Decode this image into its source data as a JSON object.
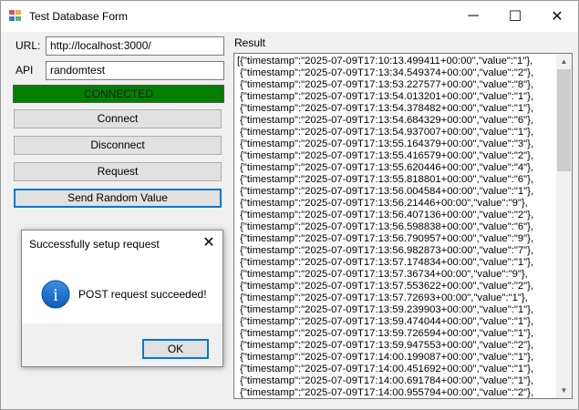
{
  "window": {
    "title": "Test Database Form",
    "minimize_glyph": "─",
    "maximize_glyph": "☐",
    "close_glyph": "✕"
  },
  "form": {
    "url_label": "URL:",
    "url_value": "http://localhost:3000/",
    "api_label": "API",
    "api_value": "randomtest",
    "status_text": "CONNECTED",
    "status_color": "#008000",
    "connect_label": "Connect",
    "disconnect_label": "Disconnect",
    "request_label": "Request",
    "send_random_label": "Send Random Value"
  },
  "result": {
    "label": "Result",
    "lines": [
      "[{\"timestamp\":\"2025-07-09T17:10:13.499411+00:00\",\"value\":\"1\"},",
      " {\"timestamp\":\"2025-07-09T17:13:34.549374+00:00\",\"value\":\"2\"},",
      " {\"timestamp\":\"2025-07-09T17:13:53.227577+00:00\",\"value\":\"8\"},",
      " {\"timestamp\":\"2025-07-09T17:13:54.013201+00:00\",\"value\":\"1\"},",
      " {\"timestamp\":\"2025-07-09T17:13:54.378482+00:00\",\"value\":\"1\"},",
      " {\"timestamp\":\"2025-07-09T17:13:54.684329+00:00\",\"value\":\"6\"},",
      " {\"timestamp\":\"2025-07-09T17:13:54.937007+00:00\",\"value\":\"1\"},",
      " {\"timestamp\":\"2025-07-09T17:13:55.164379+00:00\",\"value\":\"3\"},",
      " {\"timestamp\":\"2025-07-09T17:13:55.416579+00:00\",\"value\":\"2\"},",
      " {\"timestamp\":\"2025-07-09T17:13:55.620446+00:00\",\"value\":\"4\"},",
      " {\"timestamp\":\"2025-07-09T17:13:55.818801+00:00\",\"value\":\"6\"},",
      " {\"timestamp\":\"2025-07-09T17:13:56.004584+00:00\",\"value\":\"1\"},",
      " {\"timestamp\":\"2025-07-09T17:13:56.21446+00:00\",\"value\":\"9\"},",
      " {\"timestamp\":\"2025-07-09T17:13:56.407136+00:00\",\"value\":\"2\"},",
      " {\"timestamp\":\"2025-07-09T17:13:56.598838+00:00\",\"value\":\"6\"},",
      " {\"timestamp\":\"2025-07-09T17:13:56.790957+00:00\",\"value\":\"9\"},",
      " {\"timestamp\":\"2025-07-09T17:13:56.982873+00:00\",\"value\":\"7\"},",
      " {\"timestamp\":\"2025-07-09T17:13:57.174834+00:00\",\"value\":\"1\"},",
      " {\"timestamp\":\"2025-07-09T17:13:57.36734+00:00\",\"value\":\"9\"},",
      " {\"timestamp\":\"2025-07-09T17:13:57.553622+00:00\",\"value\":\"2\"},",
      " {\"timestamp\":\"2025-07-09T17:13:57.72693+00:00\",\"value\":\"1\"},",
      " {\"timestamp\":\"2025-07-09T17:13:59.239903+00:00\",\"value\":\"1\"},",
      " {\"timestamp\":\"2025-07-09T17:13:59.474044+00:00\",\"value\":\"1\"},",
      " {\"timestamp\":\"2025-07-09T17:13:59.726594+00:00\",\"value\":\"1\"},",
      " {\"timestamp\":\"2025-07-09T17:13:59.947553+00:00\",\"value\":\"2\"},",
      " {\"timestamp\":\"2025-07-09T17:14:00.199087+00:00\",\"value\":\"1\"},",
      " {\"timestamp\":\"2025-07-09T17:14:00.451692+00:00\",\"value\":\"1\"},",
      " {\"timestamp\":\"2025-07-09T17:14:00.691784+00:00\",\"value\":\"1\"},",
      " {\"timestamp\":\"2025-07-09T17:14:00.955794+00:00\",\"value\":\"2\"},"
    ]
  },
  "dialog": {
    "title": "Successfully setup request",
    "message": "POST request succeeded!",
    "ok_label": "OK",
    "close_glyph": "✕",
    "icon_letter": "i",
    "icon_color": "#1565c0"
  }
}
